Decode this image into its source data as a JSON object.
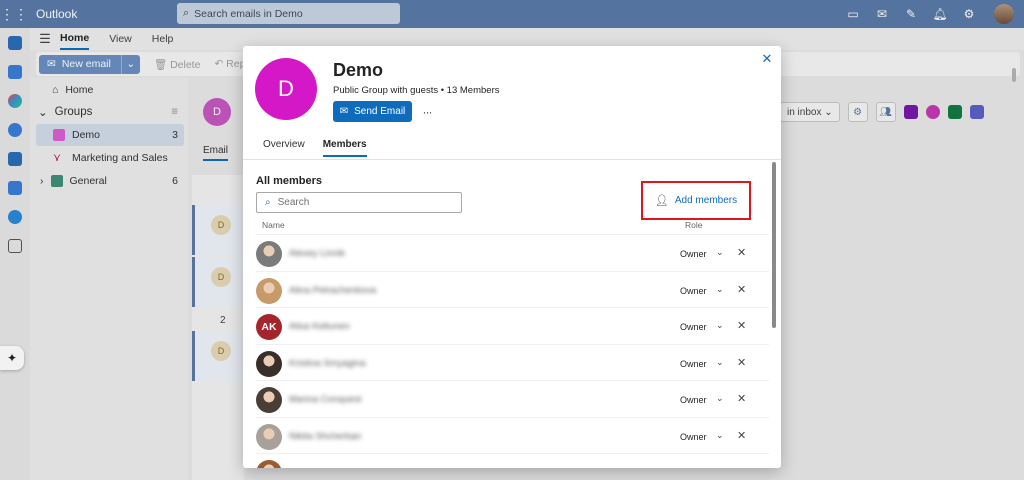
{
  "topbar": {
    "app_title": "Outlook",
    "search_placeholder": "Search emails in Demo",
    "icons": [
      "waffle-icon",
      "chat-icon",
      "outlook-mail-icon",
      "notes-icon",
      "bell-icon",
      "gear-icon"
    ]
  },
  "ribbon": {
    "tabs": [
      {
        "label": "Home",
        "active": true
      },
      {
        "label": "View",
        "active": false
      },
      {
        "label": "Help",
        "active": false
      }
    ],
    "new_email_label": "New email",
    "delete_label": "Delete",
    "reply_label": "Reply"
  },
  "folders": {
    "home_label": "Home",
    "groups_label": "Groups",
    "items": [
      {
        "label": "Demo",
        "count": "3",
        "selected": true,
        "color": "#d85fd0"
      },
      {
        "label": "Marketing and Sales",
        "count": "",
        "selected": false,
        "color": "#c2185b"
      },
      {
        "label": "General",
        "count": "6",
        "selected": false,
        "color": "#3f8f7a"
      }
    ]
  },
  "background": {
    "group_initial": "D",
    "tab_email": "Email",
    "show_in_inbox": "in inbox",
    "row_initial": "D",
    "date_group": "2"
  },
  "dialog": {
    "group_initial": "D",
    "group_name": "Demo",
    "group_meta": "Public Group with guests • 13 Members",
    "send_email_label": "Send Email",
    "more_label": "···",
    "tabs": [
      {
        "label": "Overview",
        "active": false
      },
      {
        "label": "Members",
        "active": true
      }
    ],
    "section_title": "All members",
    "search_placeholder": "Search",
    "add_members_label": "Add members",
    "col_name": "Name",
    "col_role": "Role",
    "members": [
      {
        "name": "Alexey Linnik",
        "role": "Owner",
        "avatar": "photo",
        "tone": "#7b7b7b"
      },
      {
        "name": "Alina Petrachenkova",
        "role": "Owner",
        "avatar": "photo",
        "tone": "#c79a6a"
      },
      {
        "name": "Alisa Keltunen",
        "role": "Owner",
        "avatar": "initials",
        "initials": "AK"
      },
      {
        "name": "Kristina Smyagina",
        "role": "Owner",
        "avatar": "photo",
        "tone": "#3a2e2a"
      },
      {
        "name": "Marina Conquest",
        "role": "Owner",
        "avatar": "photo",
        "tone": "#4a3d36"
      },
      {
        "name": "Nikita Shcherban",
        "role": "Owner",
        "avatar": "photo",
        "tone": "#a8a19a"
      },
      {
        "name": "",
        "role": "",
        "avatar": "photo",
        "tone": "#9a5b2e"
      }
    ]
  }
}
